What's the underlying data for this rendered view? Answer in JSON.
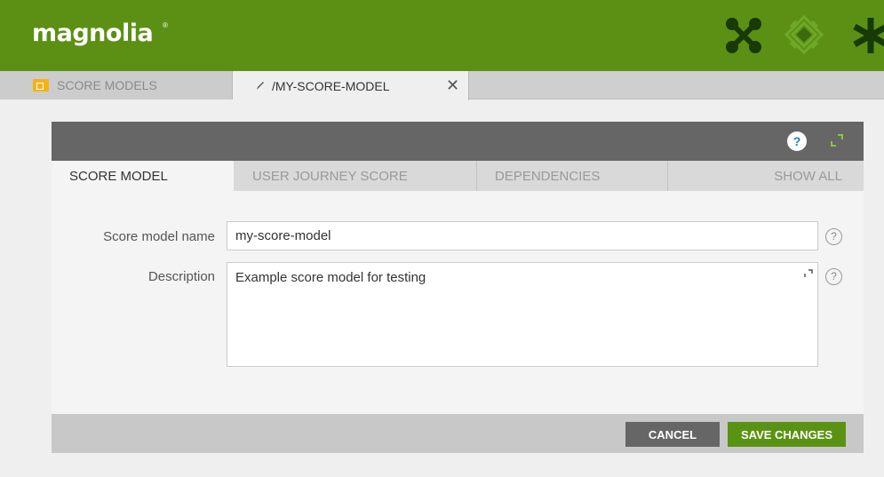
{
  "header": {
    "logo_text": "magnolia",
    "logo_mark": "®",
    "icons": [
      "apps-cross-icon",
      "pulse-diamond-icon",
      "asterisk-icon"
    ]
  },
  "tabs": {
    "app_tab": {
      "label": "Score Models",
      "icon": "content-app-icon"
    },
    "sub_tab": {
      "label": "/my-score-model",
      "icon": "pencil-icon",
      "close": "✕"
    }
  },
  "dialog": {
    "help_label": "?",
    "tabs": [
      {
        "label": "Score Model",
        "active": true
      },
      {
        "label": "User Journey Score",
        "active": false
      },
      {
        "label": "Dependencies",
        "active": false
      },
      {
        "label": "Show All",
        "active": false
      }
    ],
    "fields": {
      "name": {
        "label": "Score model name",
        "value": "my-score-model",
        "help": "?"
      },
      "description": {
        "label": "Description",
        "value": "Example score model for testing",
        "help": "?"
      }
    },
    "footer": {
      "cancel_label": "Cancel",
      "save_label": "Save changes"
    }
  },
  "colors": {
    "brand_green": "#5b9015",
    "save_green": "#5a9314",
    "dark_gray": "#666666",
    "help_blue": "#2a7ea6"
  }
}
